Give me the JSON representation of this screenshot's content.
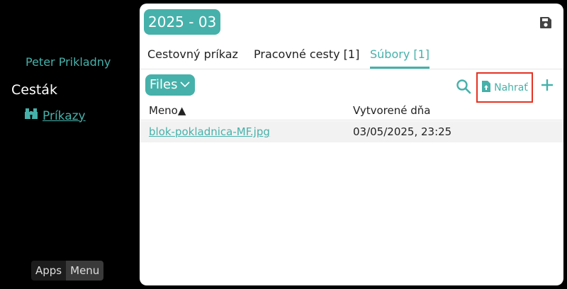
{
  "sidebar": {
    "user_name": "Peter Prikladny",
    "app_name": "Cesták",
    "nav": [
      {
        "label": "Príkazy",
        "icon": "binoculars-icon"
      }
    ],
    "bottom": {
      "apps_label": "Apps",
      "menu_label": "Menu"
    }
  },
  "main": {
    "title": "2025 - 03",
    "tabs": [
      {
        "label": "Cestovný príkaz",
        "active": false
      },
      {
        "label": "Pracovné cesty [1]",
        "active": false
      },
      {
        "label": "Súbory [1]",
        "active": true
      }
    ],
    "files_dropdown": {
      "label": "Files",
      "icon": "chevron-down-icon"
    },
    "toolbar": {
      "search_icon": "search-icon",
      "upload_label": "Nahrať",
      "upload_icon": "file-upload-icon",
      "add_icon": "plus-icon"
    },
    "table": {
      "columns": [
        "Meno▲",
        "Vytvorené dňa"
      ],
      "rows": [
        {
          "name": "blok-pokladnica-MF.jpg",
          "created": "03/05/2025, 23:25"
        }
      ]
    }
  },
  "colors": {
    "accent": "#46b1aa",
    "highlight_border": "#e53222",
    "background": "#000000",
    "panel": "#ffffff"
  }
}
